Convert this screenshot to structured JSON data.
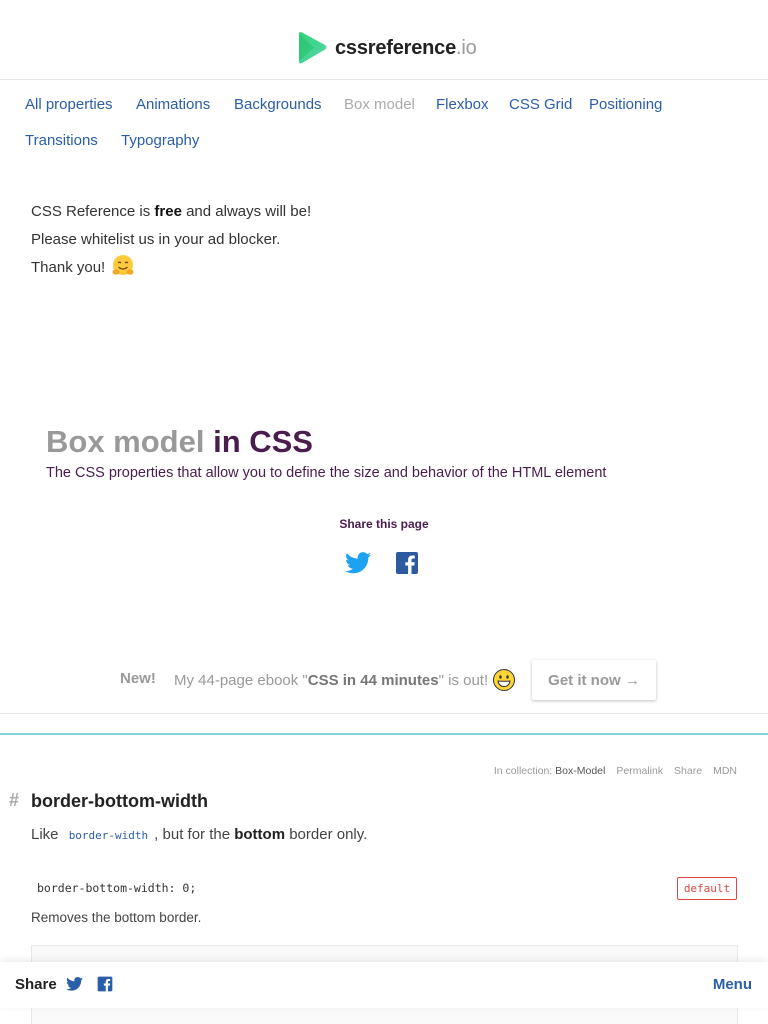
{
  "header": {
    "logo_text": "cssreference",
    "logo_suffix": ".io"
  },
  "nav": {
    "items": [
      {
        "label": "All properties"
      },
      {
        "label": "Animations"
      },
      {
        "label": "Backgrounds"
      },
      {
        "label": "Box model",
        "active": true
      },
      {
        "label": "Flexbox"
      },
      {
        "label": "CSS Grid"
      },
      {
        "label": "Positioning"
      },
      {
        "label": "Transitions"
      },
      {
        "label": "Typography"
      }
    ]
  },
  "adnote": {
    "line1_pre": "CSS Reference is ",
    "line1_bold": "free",
    "line1_post": " and always will be!",
    "line2": "Please whitelist us in your ad blocker.",
    "line3": "Thank you!"
  },
  "page": {
    "title_main": "Box model",
    "title_suffix": " in CSS",
    "subtitle": "The CSS properties that allow you to define the size and behavior of the HTML element",
    "share_label": "Share this page"
  },
  "promo": {
    "new_label": "New!",
    "msg_pre": "My 44-page ebook \"",
    "msg_bold": "CSS in 44 minutes",
    "msg_post": "\" is out!",
    "button_label": "Get it now →"
  },
  "entry": {
    "collection_label": "In collection:",
    "collection_name": "Box-Model",
    "permalink": "Permalink",
    "share": "Share",
    "mdn": "MDN",
    "hash": "#",
    "name": "border-bottom-width",
    "desc_pre": "Like ",
    "desc_code": "border-width",
    "desc_mid": ", but for the ",
    "desc_bold": "bottom",
    "desc_post": " border only.",
    "code": "border-bottom-width: 0;",
    "badge": "default",
    "removes": "Removes the bottom border."
  },
  "bottom_bar": {
    "share_label": "Share",
    "menu_label": "Menu"
  },
  "colors": {
    "link": "#2a5ea8",
    "title_purple": "#4a1d4e",
    "teal_divider": "#7fd6d4",
    "badge_red": "#e04646",
    "logo_green": "#3ccf8e"
  }
}
